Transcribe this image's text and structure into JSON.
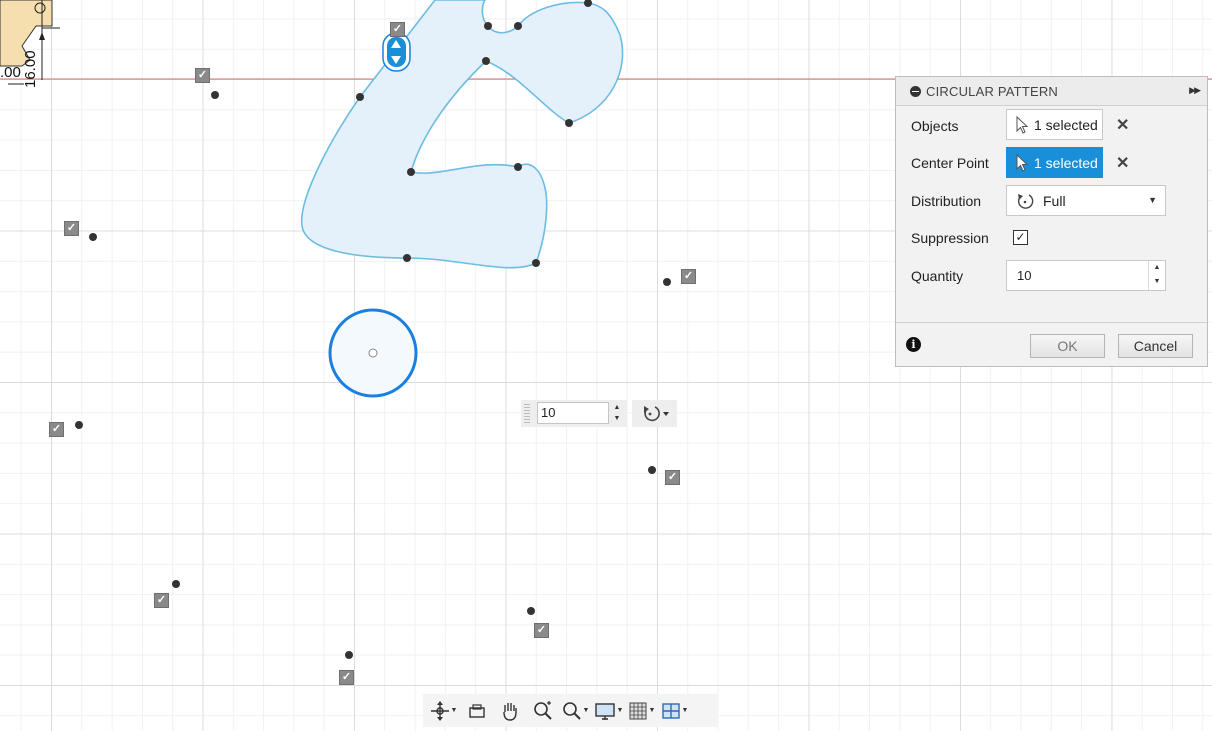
{
  "canvas": {
    "dimensions": [
      "16.00",
      ".00"
    ]
  },
  "dialog": {
    "title": "CIRCULAR PATTERN",
    "rows": {
      "objects": {
        "label": "Objects",
        "value": "1 selected"
      },
      "center_point": {
        "label": "Center Point",
        "value": "1 selected"
      },
      "distribution": {
        "label": "Distribution",
        "value": "Full"
      },
      "suppression": {
        "label": "Suppression",
        "checked": true
      },
      "quantity": {
        "label": "Quantity",
        "value": "10"
      }
    },
    "ok_label": "OK",
    "cancel_label": "Cancel"
  },
  "inline_quantity": {
    "value": "10"
  },
  "toolbar": {
    "items": [
      "orbit-icon",
      "look-at-icon",
      "pan-icon",
      "zoom-icon",
      "fit-icon",
      "display-settings-icon",
      "grid-settings-icon",
      "viewports-icon"
    ]
  },
  "colors": {
    "accent": "#1a8fd9",
    "profile_fill": "#e5f1fa",
    "profile_stroke": "#6cbce4",
    "circle_stroke": "#1a7fe0",
    "axis_red": "#e06b6b"
  }
}
